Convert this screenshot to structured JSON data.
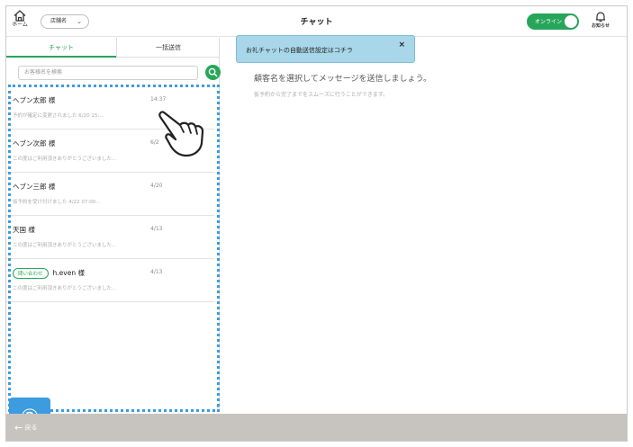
{
  "header": {
    "home_label": "ホーム",
    "store_select": "店舗名",
    "title": "チャット",
    "online_label": "オンライン",
    "notif_label": "お知らせ"
  },
  "tabs": [
    {
      "label": "チャット",
      "active": true
    },
    {
      "label": "一括送信",
      "active": false
    }
  ],
  "search": {
    "placeholder": "お客様名を検索"
  },
  "chats": [
    {
      "name": "ヘブン太郎 様",
      "date": "14:37",
      "preview": "予約が確定に変更されました 6/20 15:…"
    },
    {
      "name": "ヘブン次郎 様",
      "date": "6/2",
      "preview": "この度はご利用頂きありがとうございました…"
    },
    {
      "name": "ヘブン三郎 様",
      "date": "4/20",
      "preview": "仮予約を受け付けました 4/22 07:00…"
    },
    {
      "name": "天国 様",
      "date": "4/13",
      "preview": "この度はご利用頂きありがとうございました…"
    },
    {
      "badge": "問い合わせ",
      "name": "h.even 様",
      "date": "4/13",
      "preview": "この度はご利用頂きありがとうございました…"
    }
  ],
  "main": {
    "prompt": "顧客名を選択してメッセージを送信しましょう。",
    "sub": "仮予約から完了までをスムーズに行うことができます。"
  },
  "banner": {
    "text": "お礼チャットの自動送信設定はコチラ",
    "close": "×"
  },
  "step_marker": "②",
  "footer": {
    "back_label": "戻る"
  },
  "colors": {
    "accent": "#27a65a",
    "highlight": "#3d9bdf",
    "banner": "#a8d7ea",
    "footer": "#c7c4c0"
  }
}
